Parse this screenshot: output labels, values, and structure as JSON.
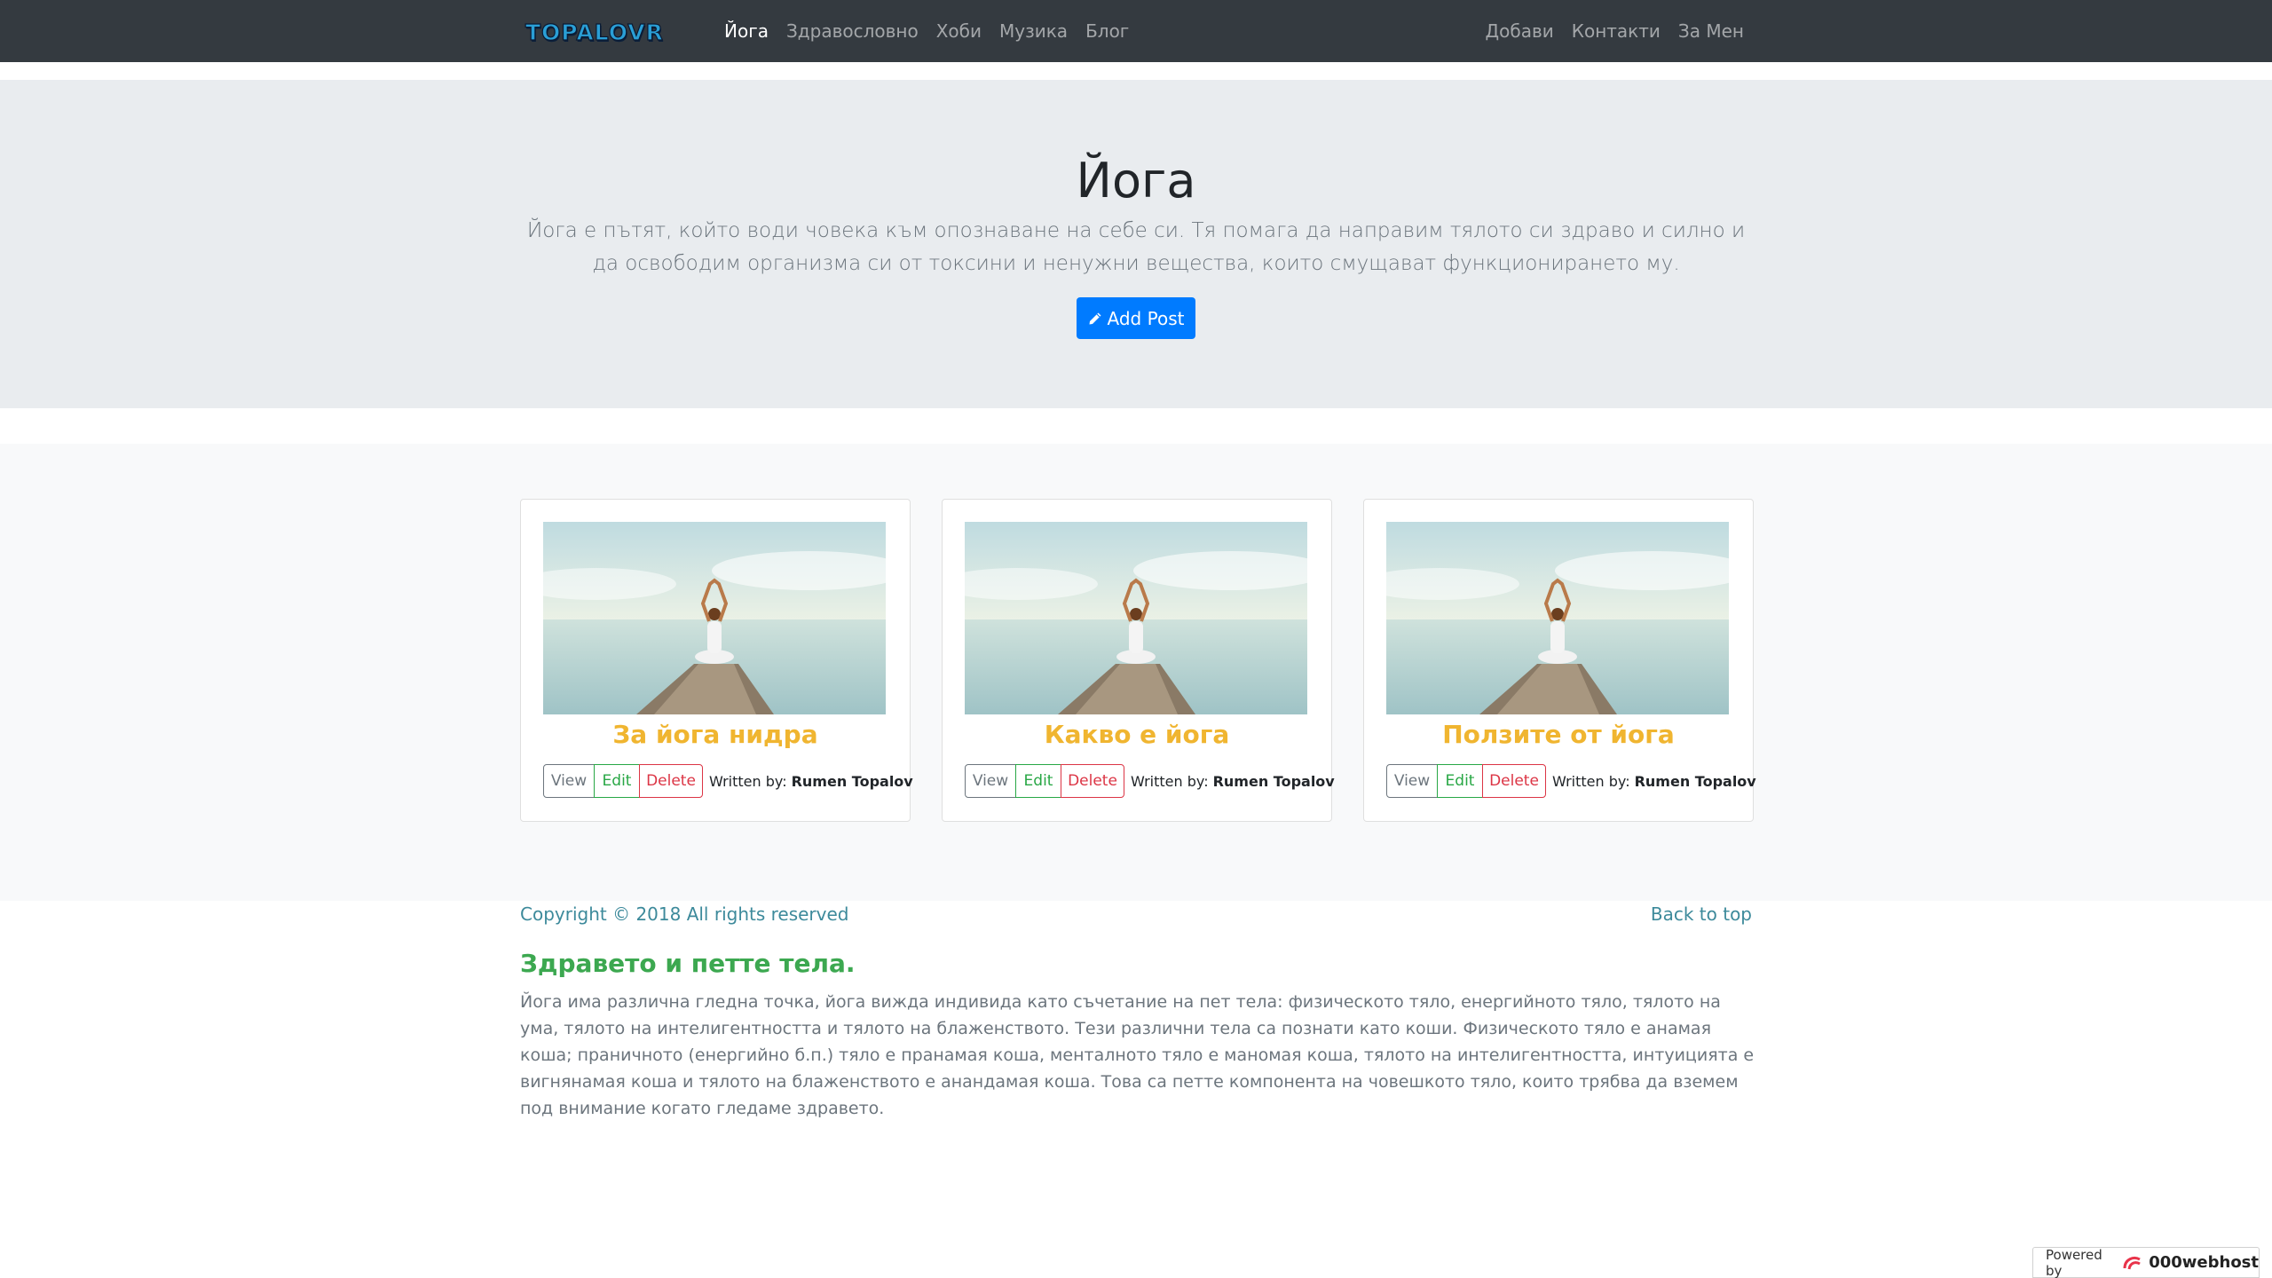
{
  "navbar": {
    "brand": "TOPALOVR",
    "left_links": [
      {
        "label": "Йога",
        "active": true
      },
      {
        "label": "Здравословно"
      },
      {
        "label": "Хоби"
      },
      {
        "label": "Музика"
      },
      {
        "label": "Блог"
      }
    ],
    "right_links": [
      {
        "label": "Добави"
      },
      {
        "label": "Контакти"
      },
      {
        "label": "За Мен"
      }
    ]
  },
  "jumbotron": {
    "title": "Йога",
    "lead": "Йога е пътят, който води човека към опознаване на себе си. Тя помага да направим тялото си здраво и силно и да освободим организма си от токсини и ненужни вещества, които смущават функционирането му.",
    "add_post_label": "Add Post",
    "add_post_icon": "pencil-icon"
  },
  "cards": [
    {
      "title": "За йога нидра",
      "view": "View",
      "edit": "Edit",
      "delete": "Delete",
      "written_by": "Written by:",
      "author": "Rumen Topalov"
    },
    {
      "title": "Какво е йога",
      "view": "View",
      "edit": "Edit",
      "delete": "Delete",
      "written_by": "Written by:",
      "author": "Rumen Topalov"
    },
    {
      "title": "Ползите от йога",
      "view": "View",
      "edit": "Edit",
      "delete": "Delete",
      "written_by": "Written by:",
      "author": "Rumen Topalov"
    }
  ],
  "footer": {
    "copyright": "Copyright © 2018 All rights reserved",
    "back_to_top": "Back to top"
  },
  "info": {
    "title": "Здравето и петте тела.",
    "text": "Йога има различна гледна точка, йога вижда индивида като съчетание на пет тела: физическото тяло, енергийното тяло, тялото на ума, тялото на интелигентността и тялото на блаженството. Тези различни тела са познати като коши. Физическото тяло е анамая коша; праничното (енергийно б.п.) тяло е пранамая коша, менталното тяло е маномая коша, тялото на интелигентността, интуицията е вигнянамая коша и тялото на блаженството е анандамая коша. Това са петте компонента на човешкото тяло, които трябва да вземем под внимание когато гледаме здравето."
  },
  "powered": {
    "label": "Powered by",
    "brand": "000webhost"
  },
  "colors": {
    "navbar": "#343a40",
    "primary": "#007bff",
    "card_title": "#f0b530",
    "info_title": "#3ca850"
  }
}
